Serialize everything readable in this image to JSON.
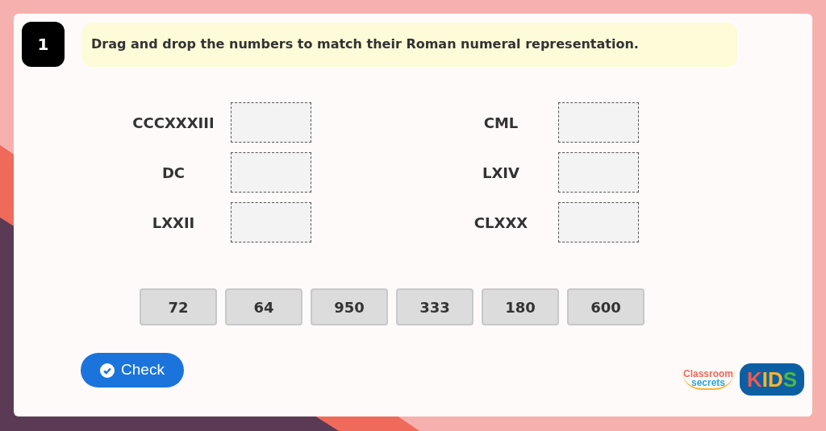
{
  "question": {
    "number": "1",
    "instruction": "Drag and drop the numbers to match their Roman numeral representation."
  },
  "pairs": [
    {
      "numeral": "CCCXXXIII"
    },
    {
      "numeral": "CML"
    },
    {
      "numeral": "DC"
    },
    {
      "numeral": "LXIV"
    },
    {
      "numeral": "LXXII"
    },
    {
      "numeral": "CLXXX"
    }
  ],
  "tiles": [
    "72",
    "64",
    "950",
    "333",
    "180",
    "600"
  ],
  "check_button": "Check",
  "logo": {
    "line_1": "Classroom",
    "line_2": "secrets",
    "kids": "KIDS"
  }
}
